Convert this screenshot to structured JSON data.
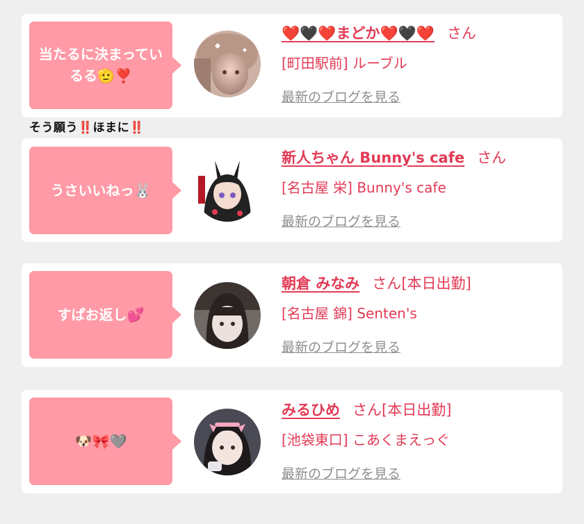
{
  "colors": {
    "accent": "#e23a55",
    "bubble": "#ff9aa6",
    "link_gray": "#8e8e8e",
    "background": "#efefef"
  },
  "cards": [
    {
      "message": "当たるに決まっているる🫡❣️",
      "name": "❤️🖤❤️まどか❤️🖤❤️",
      "honorific": "さん",
      "status": "",
      "shop": "[町田駅前] ルーブル",
      "blog_link": "最新のブログを見る"
    },
    {
      "message": "うさいいねっ🐰",
      "name": "新人ちゃん Bunny's cafe",
      "honorific": "さん",
      "status": "",
      "shop": "[名古屋 栄] Bunny's cafe",
      "blog_link": "最新のブログを見る"
    },
    {
      "message": "すぱお返し💕",
      "name": "朝倉 みなみ",
      "honorific": "さん",
      "status": "[本日出勤]",
      "shop": "[名古屋 錦] Senten's",
      "blog_link": "最新のブログを見る"
    },
    {
      "message": "🐶🎀🩶",
      "name": "みるひめ",
      "honorific": "さん",
      "status": "[本日出勤]",
      "shop": "[池袋東口] こあくまえっぐ",
      "blog_link": "最新のブログを見る"
    }
  ],
  "between_comment": {
    "text": "そう願う",
    "mark1": "‼️",
    "text2": "ほまに",
    "mark2": "‼️"
  }
}
